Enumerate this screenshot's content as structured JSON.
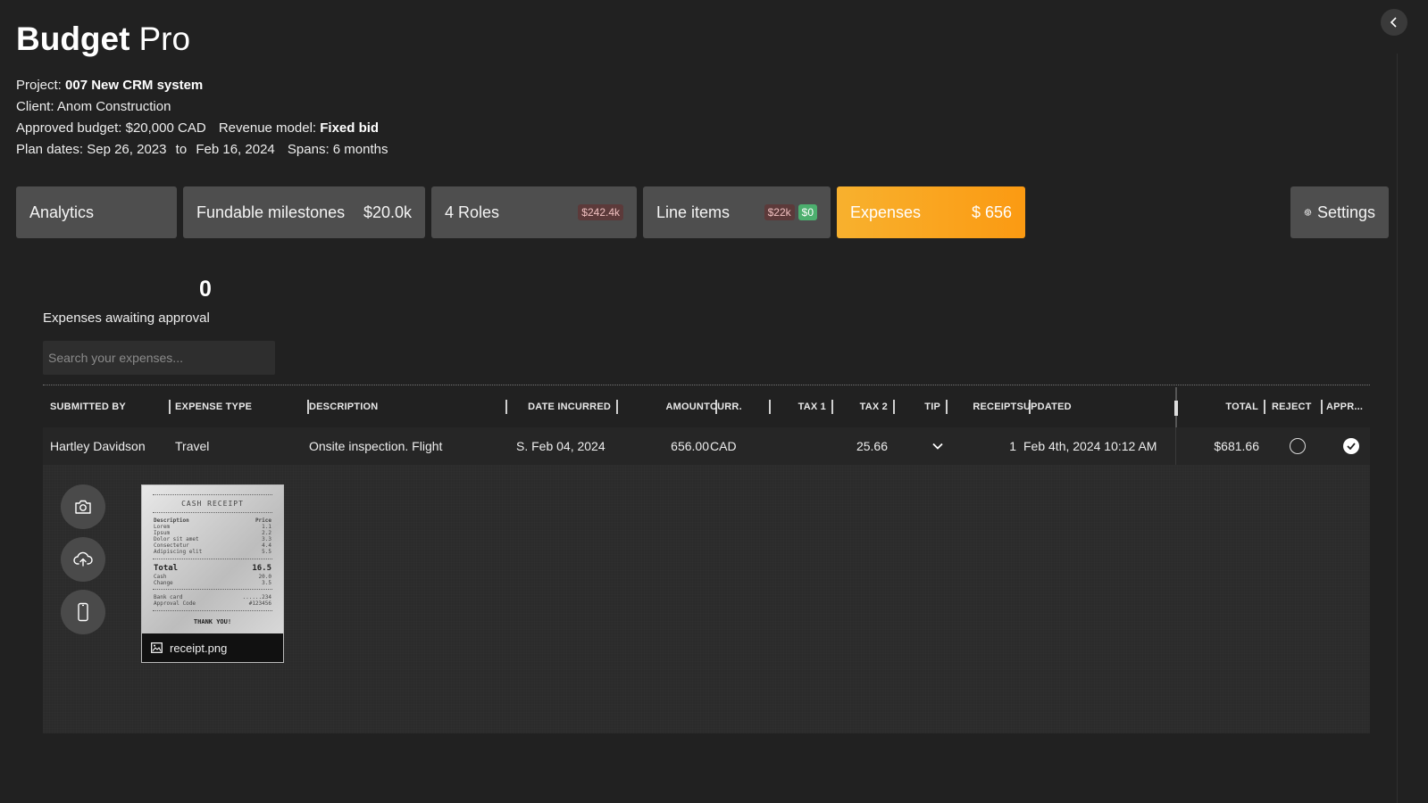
{
  "app": {
    "brand": "Budget",
    "suffix": "Pro"
  },
  "project": {
    "project_label": "Project:",
    "project_name": "007 New CRM system",
    "client_label": "Client:",
    "client_name": "Anom Construction",
    "budget_label": "Approved budget:",
    "budget_value": "$20,000 CAD",
    "revenue_label": "Revenue model:",
    "revenue_value": "Fixed bid",
    "plan_label": "Plan dates:",
    "plan_start": "Sep 26, 2023",
    "plan_to": "to",
    "plan_end": "Feb 16, 2024",
    "spans_label": "Spans:",
    "spans_value": "6 months"
  },
  "tabs": {
    "analytics": {
      "label": "Analytics"
    },
    "milestones": {
      "label": "Fundable milestones",
      "value": "$20.0k"
    },
    "roles": {
      "label": "4 Roles",
      "value": "$242.4k"
    },
    "line_items": {
      "label": "Line items",
      "value": "$22k",
      "value2": "$0"
    },
    "expenses": {
      "label": "Expenses",
      "value": "$ 656"
    },
    "settings": {
      "label": "Settings"
    }
  },
  "colors": {
    "accent": "#fb9a12",
    "accent_light": "#f8b12e",
    "background": "#212121",
    "panel": "#4e4e4e"
  },
  "summary": {
    "awaiting_count": "0",
    "awaiting_label": "Expenses awaiting approval"
  },
  "search": {
    "placeholder": "Search your expenses..."
  },
  "table": {
    "headers": {
      "submitted_by": "SUBMITTED BY",
      "expense_type": "EXPENSE TYPE",
      "description": "DESCRIPTION",
      "date_incurred": "DATE INCURRED",
      "amount": "AMOUNT",
      "currency": "CURR.",
      "tax1": "TAX 1",
      "tax2": "TAX 2",
      "tip": "TIP",
      "receipts": "RECEIPTS",
      "updated": "UPDATED",
      "total": "TOTAL",
      "reject": "REJECT",
      "approve": "APPR..."
    },
    "rows": [
      {
        "submitted_by": "Hartley Davidson",
        "expense_type": "Travel",
        "description": "Onsite inspection. Flight",
        "date_incurred": "S. Feb 04, 2024",
        "amount": "656.00",
        "currency": "CAD",
        "tax1": "",
        "tax2": "25.66",
        "tip": "",
        "receipts": "1",
        "updated": "Feb 4th, 2024 10:12 AM",
        "total": "$681.66",
        "rejected": false,
        "approved": true
      }
    ]
  },
  "detail": {
    "actions": [
      "camera-icon",
      "cloud-upload-icon",
      "phone-icon"
    ],
    "attachment": {
      "filename": "receipt.png",
      "receipt": {
        "title": "CASH RECEIPT",
        "col_desc": "Description",
        "col_price": "Price",
        "items": [
          {
            "name": "Lorem",
            "price": "1.1"
          },
          {
            "name": "Ipsum",
            "price": "2.2"
          },
          {
            "name": "Dolor sit amet",
            "price": "3.3"
          },
          {
            "name": "Consectetur",
            "price": "4.4"
          },
          {
            "name": "Adipiscing elit",
            "price": "5.5"
          }
        ],
        "total_label": "Total",
        "total_value": "16.5",
        "cash_label": "Cash",
        "cash_value": "20.0",
        "change_label": "Change",
        "change_value": "3.5",
        "card_label": "Bank card",
        "card_value": "......234",
        "approval_label": "Approval Code",
        "approval_value": "#123456",
        "thanks": "THANK YOU!"
      }
    }
  }
}
